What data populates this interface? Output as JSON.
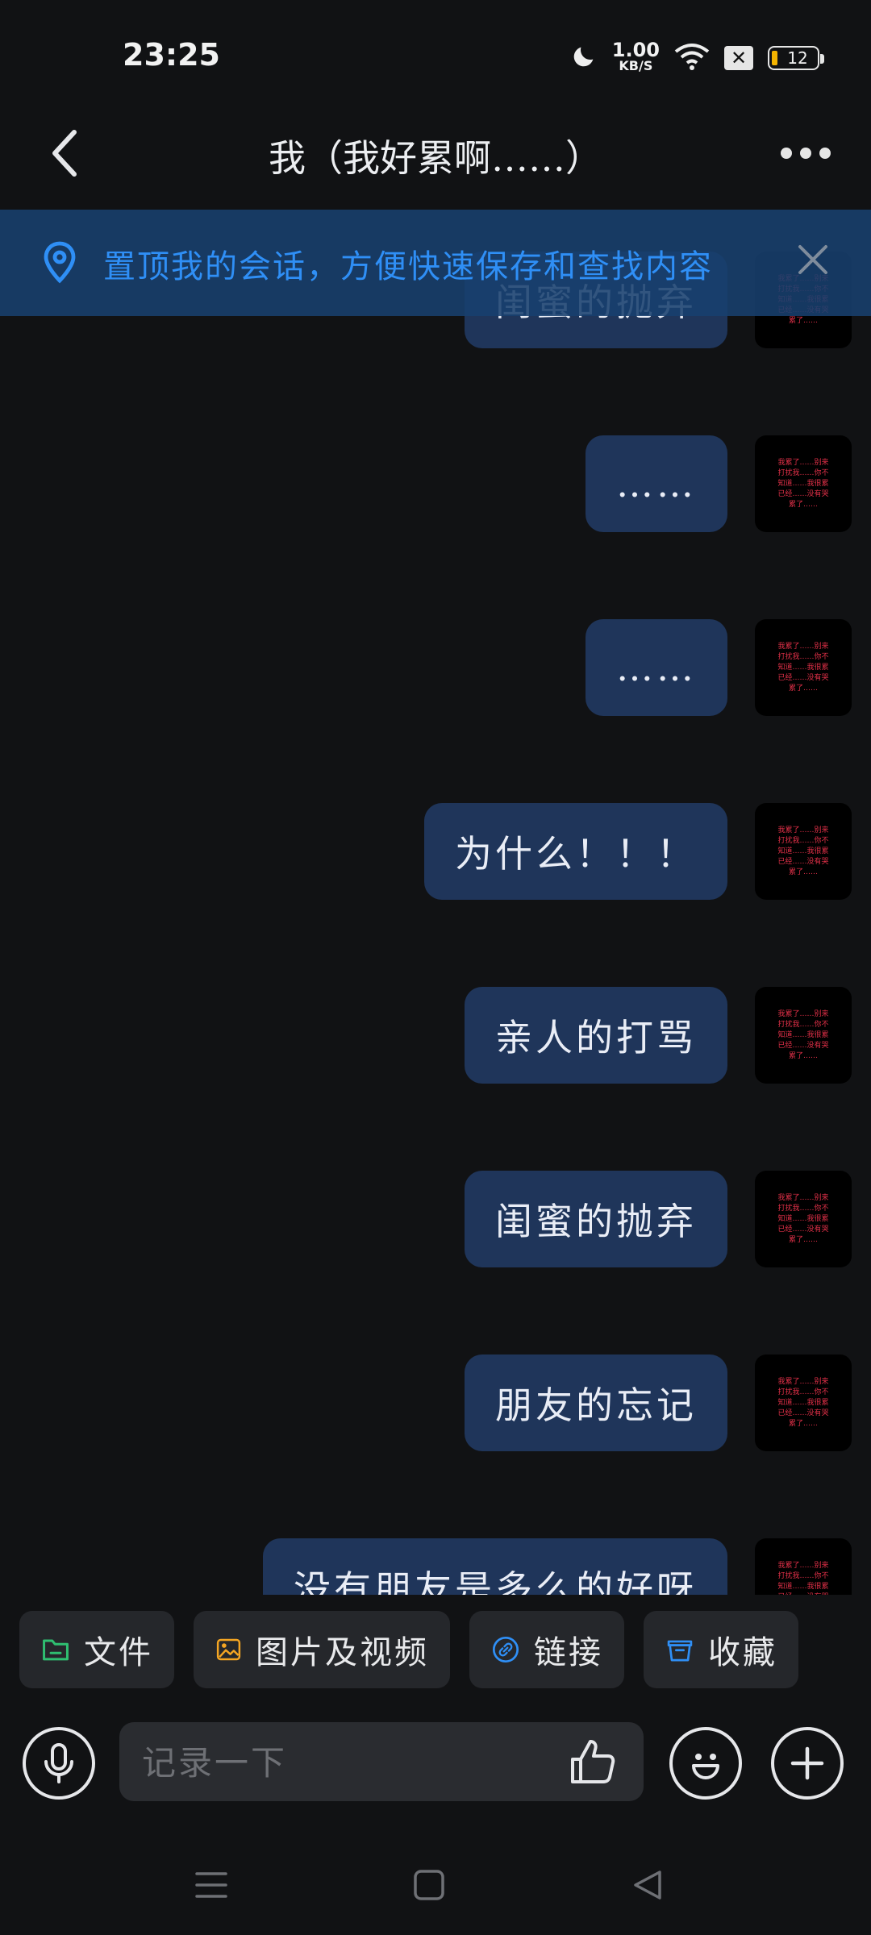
{
  "status_bar": {
    "time": "23:25",
    "speed_value": "1.00",
    "speed_unit": "KB/S",
    "battery_level": "12"
  },
  "header": {
    "title": "我（我好累啊……）"
  },
  "pin_banner": {
    "text": "置顶我的会话，方便快速保存和查找内容"
  },
  "messages": [
    {
      "text": "闺蜜的抛弃"
    },
    {
      "text": "……"
    },
    {
      "text": "……"
    },
    {
      "text": "为什么！！！"
    },
    {
      "text": "亲人的打骂"
    },
    {
      "text": "闺蜜的抛弃"
    },
    {
      "text": "朋友的忘记"
    },
    {
      "text": "没有朋友是多么的好呀"
    }
  ],
  "avatar_text": [
    "我累了……别来",
    "打扰我……你不",
    "知道……我很累",
    "已经……没有哭",
    "累了……"
  ],
  "quick_actions": [
    {
      "label": "文件",
      "icon": "folder-icon",
      "color": "#2fbf71"
    },
    {
      "label": "图片及视频",
      "icon": "image-icon",
      "color": "#f5a623"
    },
    {
      "label": "链接",
      "icon": "link-icon",
      "color": "#2f8ff6"
    },
    {
      "label": "收藏",
      "icon": "favorites-box-icon",
      "color": "#2f8ff6"
    }
  ],
  "input": {
    "placeholder": "记录一下"
  },
  "colors": {
    "background": "#111214",
    "bubble": "#1f355a",
    "accent_blue": "#2f8ff6",
    "avatar_text": "#e23048"
  }
}
